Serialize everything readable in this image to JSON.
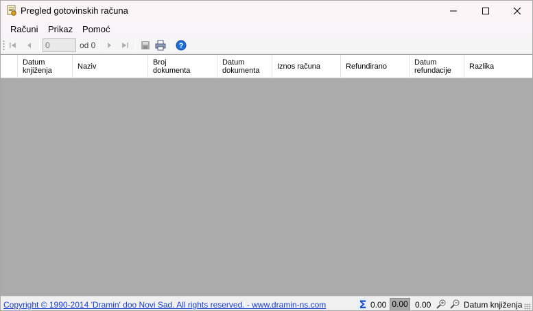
{
  "window": {
    "title": "Pregled gotovinskih računa",
    "icon": "app-invoice-icon"
  },
  "menu": {
    "items": [
      "Računi",
      "Prikaz",
      "Pomoć"
    ]
  },
  "toolbar": {
    "position_value": "0",
    "of_label": "od 0",
    "icons": [
      "move-first-icon",
      "move-previous-icon",
      "move-next-icon",
      "move-last-icon",
      "save-icon",
      "print-icon",
      "help-icon"
    ]
  },
  "grid": {
    "columns": [
      "Datum\nknjiženja",
      "Naziv",
      "Broj\ndokumenta",
      "Datum\ndokumenta",
      "Iznos računa",
      "Refundirano",
      "Datum\nrefundacije",
      "Razlika"
    ],
    "rows": []
  },
  "status": {
    "copyright": "Copyright © 1990-2014 'Dramin' doo Novi Sad. All rights reserved. - www.dramin-ns.com",
    "sum1": "0.00",
    "sum2": "0.00",
    "sum3": "0.00",
    "sort_label": "Datum knjiženja"
  },
  "colors": {
    "grid_background": "#ababab",
    "link": "#1a3fd6",
    "help_blue": "#1e6fd9"
  }
}
